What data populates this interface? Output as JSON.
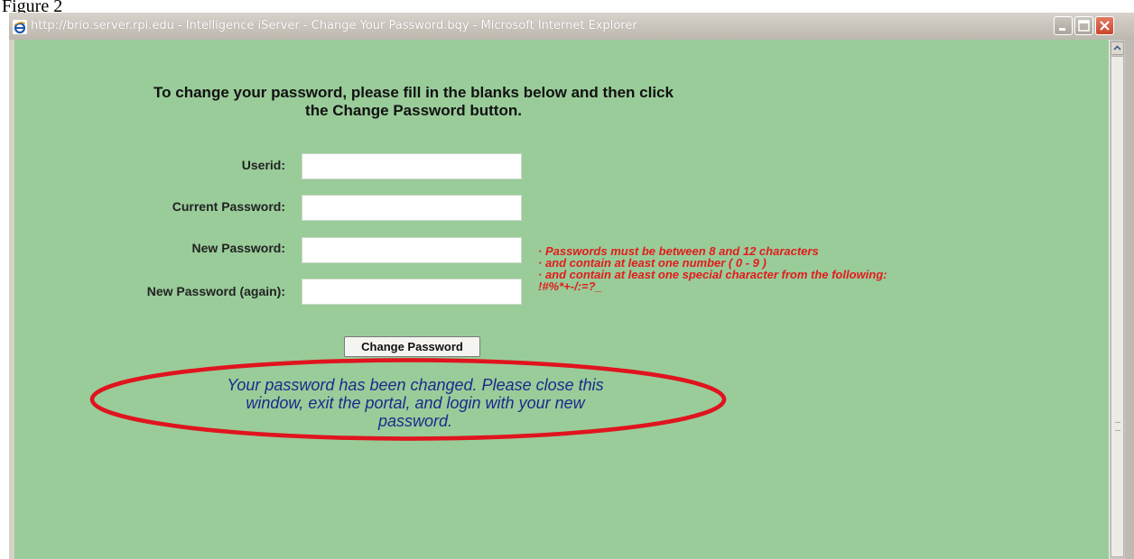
{
  "figure_label": "Figure 2",
  "window": {
    "title": "http://brio.server.rpi.edu - Intelligence iServer - Change Your Password.bqy - Microsoft Internet Explorer",
    "title_icon": "ie-icon",
    "controls": [
      "minimize-icon",
      "maximize-icon",
      "close-icon"
    ]
  },
  "page": {
    "instructions_line1": "To change your password, please fill in the blanks below and then click",
    "instructions_line2": "the Change Password button.",
    "fields": {
      "userid_label": "Userid:",
      "userid_value": "",
      "current_password_label": "Current Password:",
      "current_password_value": "",
      "new_password_label": "New Password:",
      "new_password_value": "",
      "new_password_again_label": "New Password (again):",
      "new_password_again_value": ""
    },
    "rules": [
      "· Passwords must be between 8 and 12 characters",
      "· and contain at least one number ( 0 - 9 )",
      "· and contain at least one special character from the following:",
      "!#%*+-/:=?_"
    ],
    "submit_label": "Change Password",
    "success_line1": "Your password has been changed. Please close this",
    "success_line2": "window, exit the portal, and login with your new",
    "success_line3": "password."
  },
  "colors": {
    "page_background": "#99cc99",
    "rule_text": "#e31b1b",
    "success_text": "#1c2a8c",
    "highlight_ellipse": "#e0141e"
  }
}
